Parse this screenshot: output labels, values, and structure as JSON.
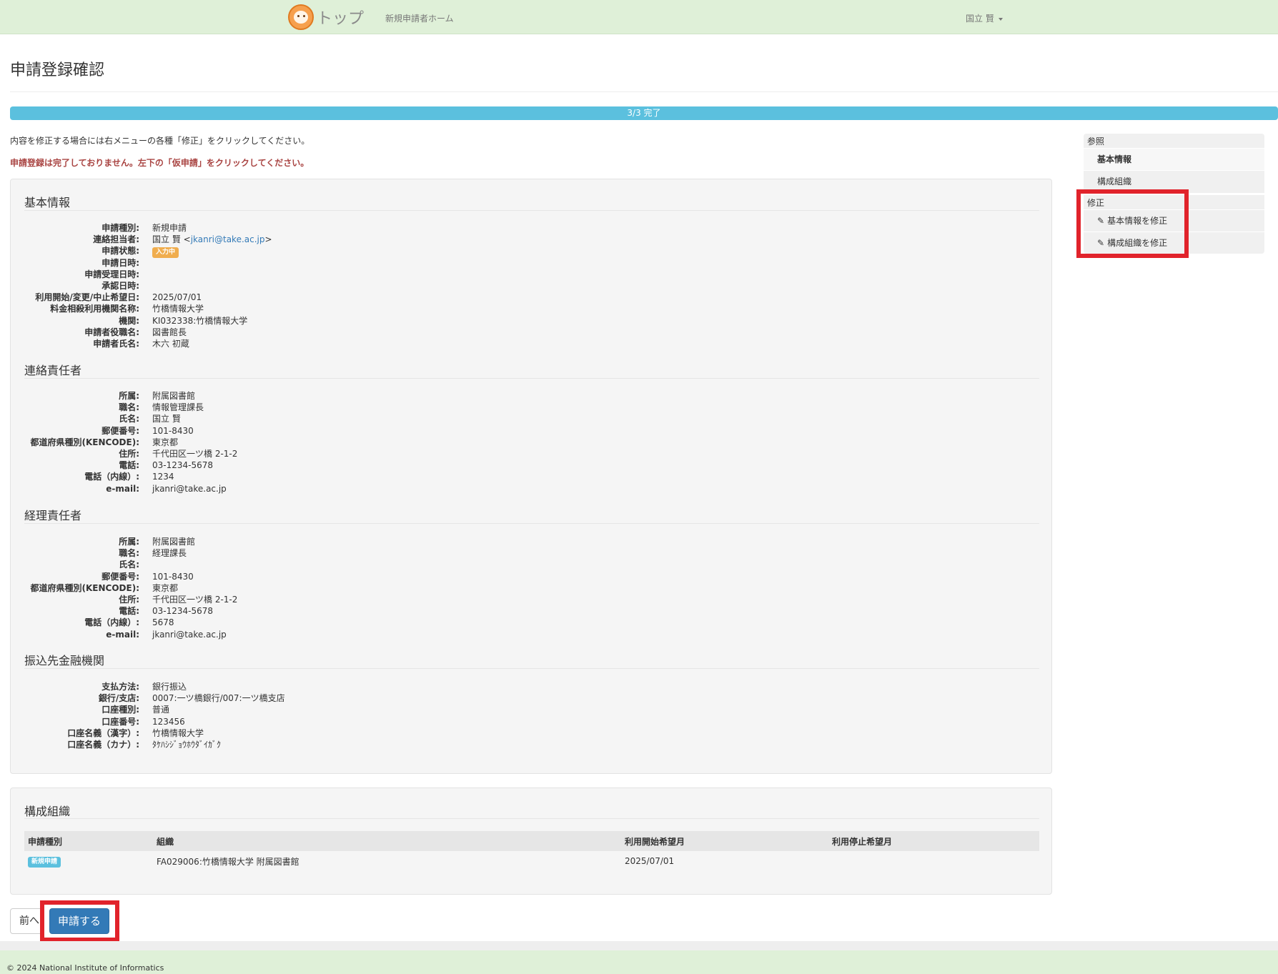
{
  "navbar": {
    "brand_label": "トップ",
    "home_link": "新規申請者ホーム",
    "user_name": "国立 賢"
  },
  "page": {
    "title": "申請登録確認",
    "progress_text": "3/3 完了",
    "progress_fraction": 1.0,
    "info_text": "内容を修正する場合には右メニューの各種「修正」をクリックしてください。",
    "warning_text": "申請登録は完了しておりません。左下の「仮申請」をクリックしてください。"
  },
  "basic": {
    "title": "基本情報",
    "rows": [
      {
        "label": "申請種別:",
        "value": "新規申請"
      },
      {
        "label": "連絡担当者:",
        "value": "国立 賢 <",
        "email": "jkanri@take.ac.jp",
        "suffix": ">"
      },
      {
        "label": "申請状態:",
        "badge": "入力中"
      },
      {
        "label": "申請日時:",
        "value": ""
      },
      {
        "label": "申請受理日時:",
        "value": ""
      },
      {
        "label": "承認日時:",
        "value": ""
      },
      {
        "label": "利用開始/変更/中止希望日:",
        "value": "2025/07/01"
      },
      {
        "label": "料金相殺利用機関名称:",
        "value": "竹橋情報大学"
      },
      {
        "label": "機関:",
        "value": "KI032338:竹橋情報大学"
      },
      {
        "label": "申請者役職名:",
        "value": "図書館長"
      },
      {
        "label": "申請者氏名:",
        "value": "木六 初蔵"
      }
    ]
  },
  "contact": {
    "title": "連絡責任者",
    "rows": [
      {
        "label": "所属:",
        "value": "附属図書館"
      },
      {
        "label": "職名:",
        "value": "情報管理課長"
      },
      {
        "label": "氏名:",
        "value": "国立 賢"
      },
      {
        "label": "郵便番号:",
        "value": "101-8430"
      },
      {
        "label": "都道府県種別(KENCODE):",
        "value": "東京都"
      },
      {
        "label": "住所:",
        "value": "千代田区一ツ橋 2-1-2"
      },
      {
        "label": "電話:",
        "value": "03-1234-5678"
      },
      {
        "label": "電話（内線）:",
        "value": "1234"
      },
      {
        "label": "e-mail:",
        "value": "jkanri@take.ac.jp"
      }
    ]
  },
  "accounting": {
    "title": "経理責任者",
    "rows": [
      {
        "label": "所属:",
        "value": "附属図書館"
      },
      {
        "label": "職名:",
        "value": "経理課長"
      },
      {
        "label": "氏名:",
        "value": ""
      },
      {
        "label": "郵便番号:",
        "value": "101-8430"
      },
      {
        "label": "都道府県種別(KENCODE):",
        "value": "東京都"
      },
      {
        "label": "住所:",
        "value": "千代田区一ツ橋 2-1-2"
      },
      {
        "label": "電話:",
        "value": "03-1234-5678"
      },
      {
        "label": "電話（内線）:",
        "value": "5678"
      },
      {
        "label": "e-mail:",
        "value": "jkanri@take.ac.jp"
      }
    ]
  },
  "bank": {
    "title": "振込先金融機関",
    "rows": [
      {
        "label": "支払方法:",
        "value": "銀行振込"
      },
      {
        "label": "銀行/支店:",
        "value": "0007:一ツ橋銀行/007:一ツ橋支店"
      },
      {
        "label": "口座種別:",
        "value": "普通"
      },
      {
        "label": "口座番号:",
        "value": "123456"
      },
      {
        "label": "口座名義（漢字）:",
        "value": "竹橋情報大学"
      },
      {
        "label": "口座名義（カナ）:",
        "value": "ﾀｹﾊｼｼﾞｮｳﾎｳﾀﾞｲｶﾞｸ"
      }
    ]
  },
  "org": {
    "title": "構成組織",
    "headers": [
      "申請種別",
      "組織",
      "利用開始希望月",
      "利用停止希望月"
    ],
    "rows": [
      {
        "type_badge": "新規申請",
        "org": "FA029006:竹橋情報大学 附属図書館",
        "start": "2025/07/01",
        "end": ""
      }
    ]
  },
  "buttons": {
    "prev": "前へ",
    "submit": "申請する"
  },
  "side": {
    "ref_heading": "参照",
    "ref_items": [
      "基本情報",
      "構成組織"
    ],
    "edit_heading": "修正",
    "edit_items": [
      "基本情報を修正",
      "構成組織を修正"
    ]
  },
  "footer": {
    "text": "© 2024 National Institute of Informatics"
  },
  "colors": {
    "navbar_bg": "#dff0d8",
    "progress": "#5bc0de",
    "primary": "#337ab7",
    "warning_text": "#a94442",
    "highlight": "#e1232b"
  }
}
